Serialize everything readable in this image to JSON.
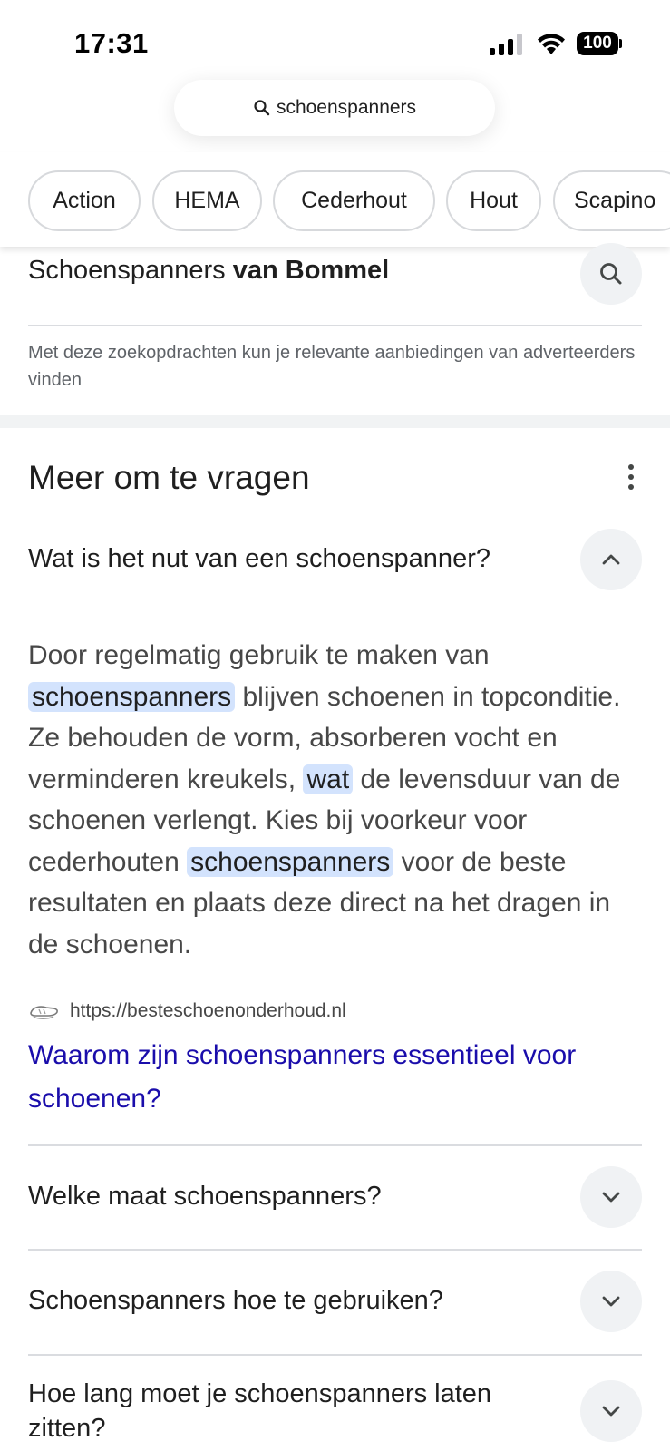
{
  "status_bar": {
    "time": "17:31",
    "battery": "100"
  },
  "search": {
    "query": "schoenspanners",
    "icon": "search-icon"
  },
  "chips": [
    "Action",
    "HEMA",
    "Cederhout",
    "Hout",
    "Scapino"
  ],
  "related": {
    "prefix": "Schoenspanners ",
    "bold": "van Bommel",
    "ad_note": "Met deze zoekopdrachten kun je relevante aanbiedingen van adverteerders vinden"
  },
  "paa": {
    "title": "Meer om te vragen",
    "questions": [
      "Wat is het nut van een schoenspanner?",
      "Welke maat schoenspanners?",
      "Schoenspanners hoe te gebruiken?",
      "Hoe lang moet je schoenspanners laten zitten?"
    ],
    "answer": {
      "p1": "Door regelmatig gebruik te maken van ",
      "h1": "schoenspanners",
      "p2": " blijven schoenen in topconditie. Ze behouden de vorm, absorberen vocht en verminderen kreukels, ",
      "h2": "wat",
      "p3": " de levensduur van de schoenen verlengt. Kies bij voorkeur voor cederhouten ",
      "h3": "schoenspanners",
      "p4": " voor de beste resultaten en plaats deze direct na het dragen in de schoenen."
    },
    "source_url": "https://besteschoenonderhoud.nl",
    "source_title": "Waarom zijn schoenspanners essentieel voor schoenen?"
  },
  "colors": {
    "link": "#1a0dab",
    "highlight": "#d3e3fd",
    "chip_border": "#d7d9dc"
  }
}
